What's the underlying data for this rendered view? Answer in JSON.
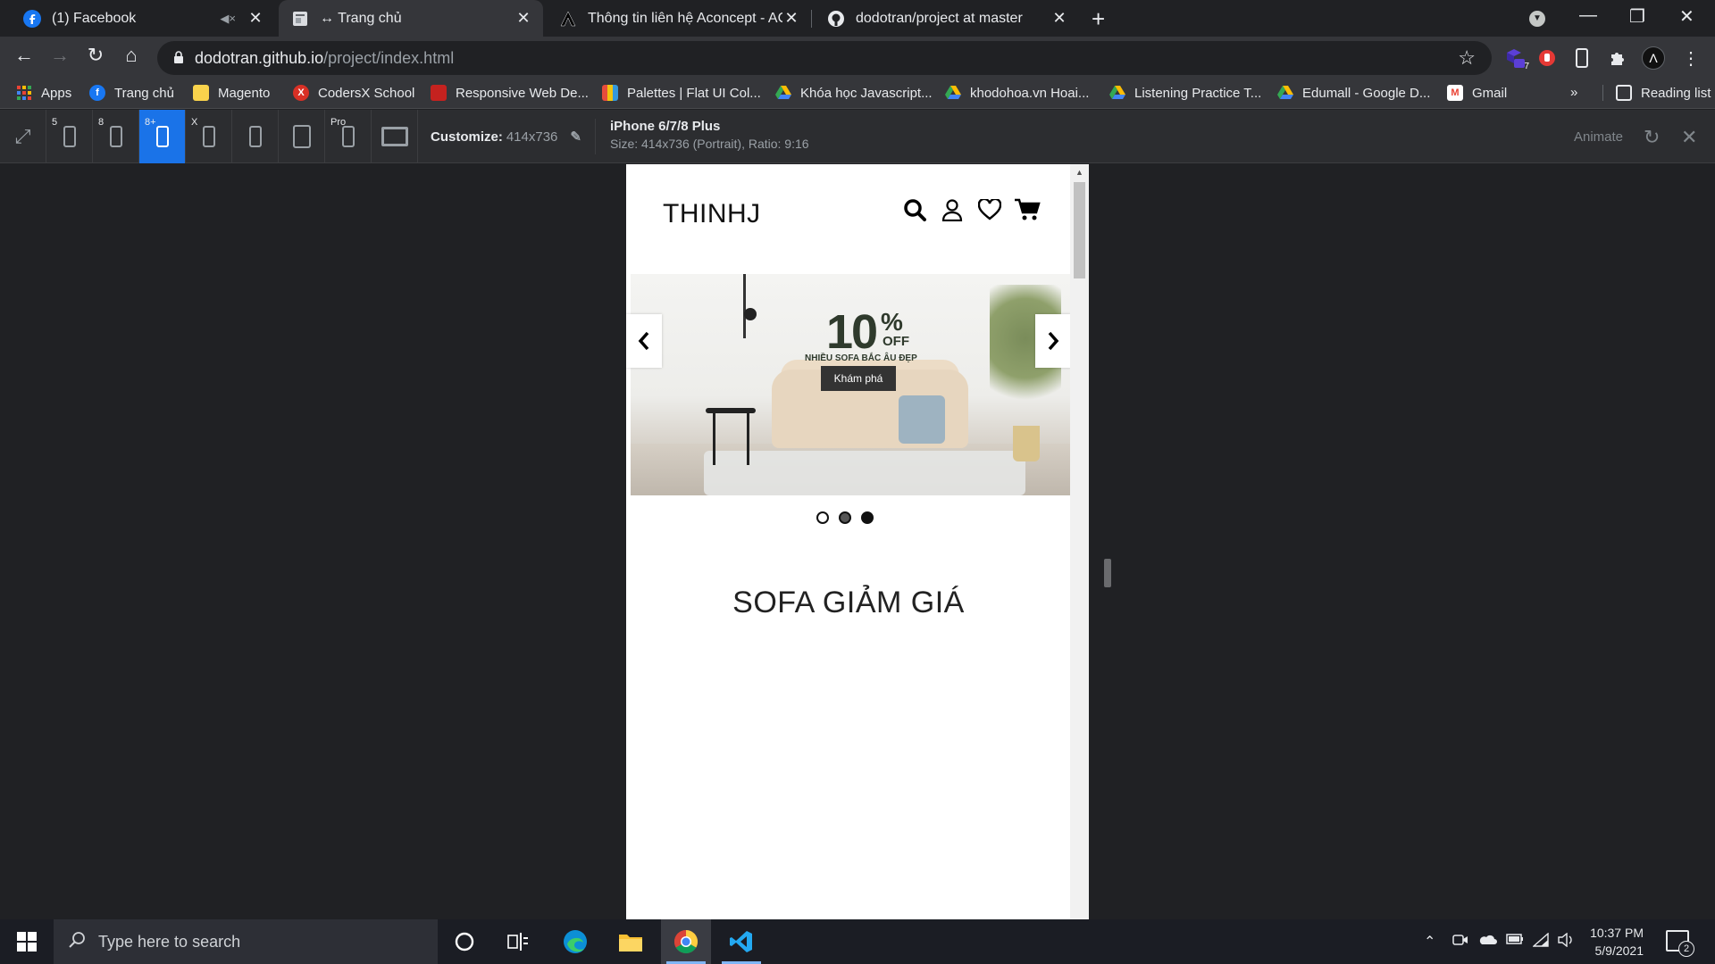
{
  "browser": {
    "tabs": [
      {
        "label": "(1) Facebook",
        "icon": "facebook-icon",
        "muted": true
      },
      {
        "label": "↔ Trang chủ",
        "icon": "page-icon",
        "active": true
      },
      {
        "label": "Thông tin liên hệ Aconcept - ACc",
        "icon": "aconcept-icon"
      },
      {
        "label": "dodotran/project at master",
        "icon": "github-icon"
      }
    ],
    "address": {
      "host": "dodotran.github.io",
      "path": "/project/index.html"
    },
    "extension_badge": "7",
    "profile_initial": "Λ"
  },
  "bookmarks": {
    "items": [
      {
        "label": "Apps",
        "color": "#ea4335"
      },
      {
        "label": "Trang chủ",
        "color": "#1877f2"
      },
      {
        "label": "Magento",
        "color": "#f9d34c"
      },
      {
        "label": "CodersX School",
        "color": "#d93025"
      },
      {
        "label": "Responsive Web De...",
        "color": "#c5221f"
      },
      {
        "label": "Palettes | Flat UI Col...",
        "color": "#e67e22"
      },
      {
        "label": "Khóa học Javascript...",
        "color": "#1fa463"
      },
      {
        "label": "khodohoa.vn Hoai...",
        "color": "#1fa463"
      },
      {
        "label": "Listening Practice T...",
        "color": "#1fa463"
      },
      {
        "label": "Edumall - Google D...",
        "color": "#1fa463"
      },
      {
        "label": "Gmail",
        "color": "#ea4335"
      }
    ],
    "overflow": "»",
    "reading_list": "Reading list"
  },
  "responsive_bar": {
    "devices": [
      {
        "label": "5",
        "kind": "phone"
      },
      {
        "label": "8",
        "kind": "phone"
      },
      {
        "label": "8+",
        "kind": "phone",
        "selected": true
      },
      {
        "label": "X",
        "kind": "phone"
      },
      {
        "label": "",
        "kind": "phone"
      },
      {
        "label": "",
        "kind": "tablet"
      },
      {
        "label": "Pro",
        "kind": "phone"
      },
      {
        "label": "",
        "kind": "monitor"
      }
    ],
    "customize_label": "Customize:",
    "customize_value": "414x736",
    "device_name": "iPhone 6/7/8 Plus",
    "device_size": "Size: 414x736 (Portrait), Ratio: 9:16",
    "animate_label": "Animate"
  },
  "site": {
    "logo": "THINHJ",
    "icons": [
      "search-icon",
      "user-icon",
      "heart-icon",
      "cart-icon"
    ],
    "slider": {
      "promo_number": "10",
      "promo_percent": "%",
      "promo_off": "OFF",
      "promo_subtitle": "NHIỀU SOFA BẮC ÂU ĐẸP",
      "button_label": "Khám phá",
      "dots": 3,
      "active_dot": 1
    },
    "section_title": "SOFA GIẢM GIÁ"
  },
  "taskbar": {
    "search_placeholder": "Type here to search",
    "apps": [
      "cortana-icon",
      "task-view-icon",
      "edge-icon",
      "file-explorer-icon",
      "chrome-icon",
      "vscode-icon"
    ],
    "time": "10:37 PM",
    "date": "5/9/2021",
    "notifications": "2"
  }
}
